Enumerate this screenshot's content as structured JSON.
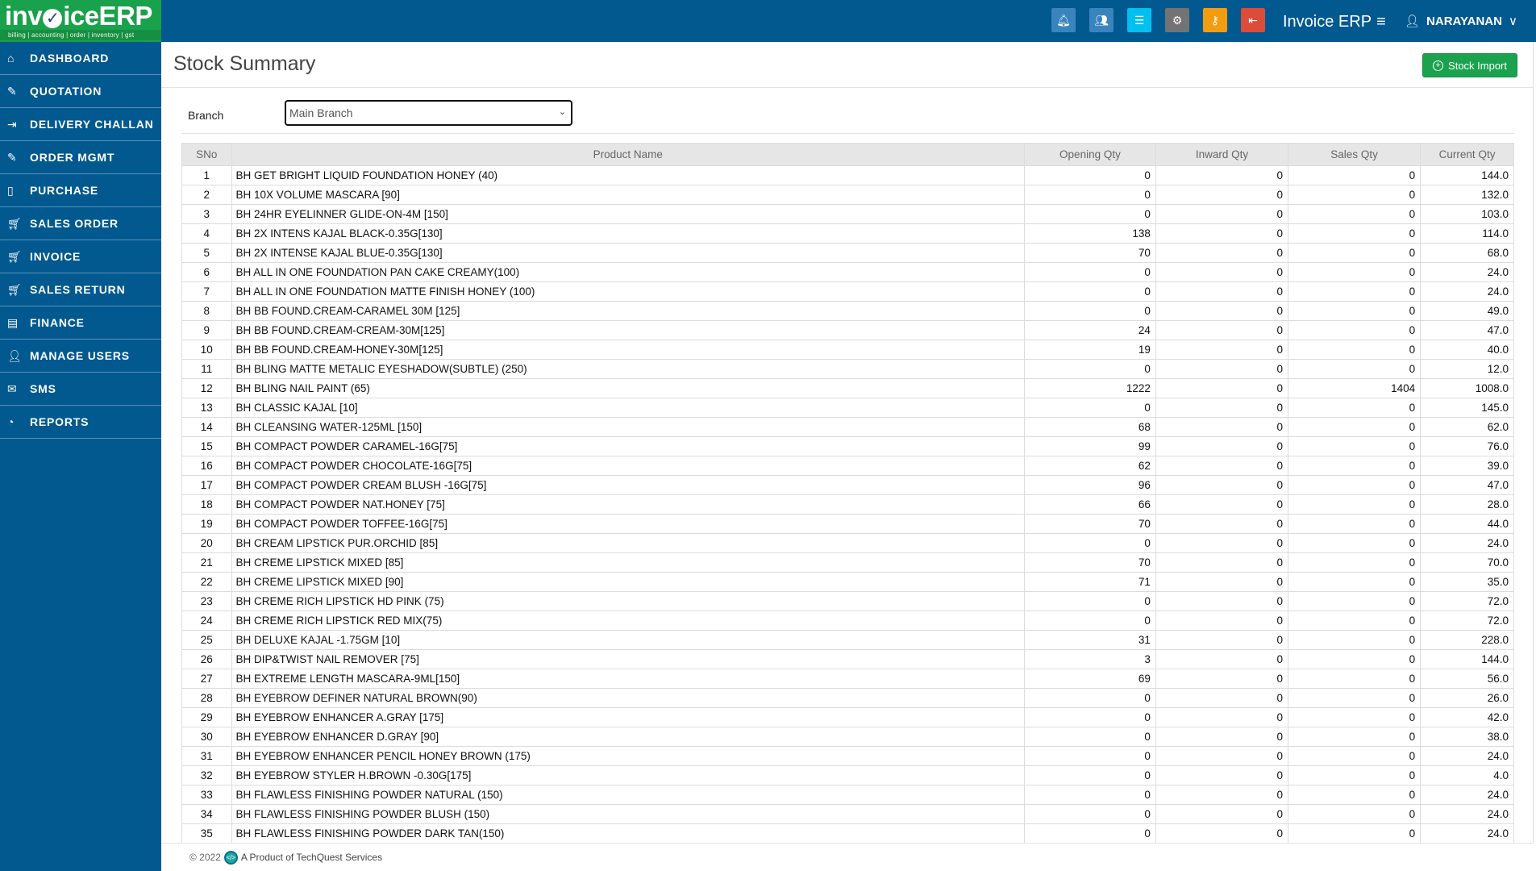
{
  "logo": {
    "brand_pre": "inv",
    "brand_v": "✓",
    "brand_post": "iceERP",
    "tagline": "billing | accounting | order | inventory | gst"
  },
  "topbar": {
    "icons": [
      {
        "name": "bell-icon",
        "glyph": "🔔︎",
        "color": "#3a84bd"
      },
      {
        "name": "users-icon",
        "glyph": "👥︎",
        "color": "#3a84bd"
      },
      {
        "name": "list-icon",
        "glyph": "☰",
        "color": "#00c0ef"
      },
      {
        "name": "gear-icon",
        "glyph": "⚙",
        "color": "#737373"
      },
      {
        "name": "key-icon",
        "glyph": "⚷",
        "color": "#f39c12"
      },
      {
        "name": "logout-icon",
        "glyph": "⇤",
        "color": "#dd4b39"
      }
    ],
    "app_title": "Invoice ERP",
    "menu_glyph": "≡",
    "user_glyph": "👤︎",
    "user_name": "NARAYANAN",
    "user_chevron": "∨"
  },
  "sidebar": {
    "items": [
      {
        "label": "DASHBOARD",
        "icon": "⌂",
        "icon_name": "home-icon"
      },
      {
        "label": "QUOTATION",
        "icon": "✎",
        "icon_name": "edit-icon"
      },
      {
        "label": "DELIVERY CHALLAN",
        "icon": "⇥",
        "icon_name": "sign-in-icon"
      },
      {
        "label": "ORDER MGMT",
        "icon": "✎",
        "icon_name": "edit-icon"
      },
      {
        "label": "PURCHASE",
        "icon": "▯",
        "icon_name": "bag-icon"
      },
      {
        "label": "SALES ORDER",
        "icon": "🛒︎",
        "icon_name": "cart-icon"
      },
      {
        "label": "INVOICE",
        "icon": "🛒︎",
        "icon_name": "cart-icon"
      },
      {
        "label": "SALES RETURN",
        "icon": "🛒︎",
        "icon_name": "cart-icon"
      },
      {
        "label": "FINANCE",
        "icon": "▤",
        "icon_name": "book-icon"
      },
      {
        "label": "MANAGE USERS",
        "icon": "👤︎",
        "icon_name": "user-icon"
      },
      {
        "label": "SMS",
        "icon": "✉",
        "icon_name": "envelope-icon"
      },
      {
        "label": "REPORTS",
        "icon": "◔",
        "icon_name": "pie-chart-icon"
      }
    ]
  },
  "page": {
    "title": "Stock Summary",
    "stock_import_label": "Stock Import",
    "stock_import_glyph": "+",
    "branch_label": "Branch",
    "branch_selected": "Main Branch",
    "select_chevron": "⌄"
  },
  "table": {
    "columns": [
      "SNo",
      "Product Name",
      "Opening Qty",
      "Inward Qty",
      "Sales Qty",
      "Current Qty"
    ],
    "rows": [
      [
        "1",
        "BH GET BRIGHT LIQUID FOUNDATION HONEY (40)",
        "0",
        "0",
        "0",
        "144.0"
      ],
      [
        "2",
        "BH 10X VOLUME MASCARA [90]",
        "0",
        "0",
        "0",
        "132.0"
      ],
      [
        "3",
        "BH 24HR EYELINNER GLIDE-ON-4M [150]",
        "0",
        "0",
        "0",
        "103.0"
      ],
      [
        "4",
        "BH 2X INTENS KAJAL BLACK-0.35G[130]",
        "138",
        "0",
        "0",
        "114.0"
      ],
      [
        "5",
        "BH 2X INTENSE KAJAL BLUE-0.35G[130]",
        "70",
        "0",
        "0",
        "68.0"
      ],
      [
        "6",
        "BH ALL IN ONE FOUNDATION PAN CAKE CREAMY(100)",
        "0",
        "0",
        "0",
        "24.0"
      ],
      [
        "7",
        "BH ALL IN ONE FOUNDATION MATTE FINISH HONEY (100)",
        "0",
        "0",
        "0",
        "24.0"
      ],
      [
        "8",
        "BH BB FOUND.CREAM-CARAMEL 30M [125]",
        "0",
        "0",
        "0",
        "49.0"
      ],
      [
        "9",
        "BH BB FOUND.CREAM-CREAM-30M[125]",
        "24",
        "0",
        "0",
        "47.0"
      ],
      [
        "10",
        "BH BB FOUND.CREAM-HONEY-30M[125]",
        "19",
        "0",
        "0",
        "40.0"
      ],
      [
        "11",
        "BH BLING MATTE METALIC EYESHADOW(SUBTLE) (250)",
        "0",
        "0",
        "0",
        "12.0"
      ],
      [
        "12",
        "BH BLING NAIL PAINT (65)",
        "1222",
        "0",
        "1404",
        "1008.0"
      ],
      [
        "13",
        "BH CLASSIC KAJAL [10]",
        "0",
        "0",
        "0",
        "145.0"
      ],
      [
        "14",
        "BH CLEANSING WATER-125ML [150]",
        "68",
        "0",
        "0",
        "62.0"
      ],
      [
        "15",
        "BH COMPACT POWDER CARAMEL-16G[75]",
        "99",
        "0",
        "0",
        "76.0"
      ],
      [
        "16",
        "BH COMPACT POWDER CHOCOLATE-16G[75]",
        "62",
        "0",
        "0",
        "39.0"
      ],
      [
        "17",
        "BH COMPACT POWDER CREAM BLUSH -16G[75]",
        "96",
        "0",
        "0",
        "47.0"
      ],
      [
        "18",
        "BH COMPACT POWDER NAT.HONEY [75]",
        "66",
        "0",
        "0",
        "28.0"
      ],
      [
        "19",
        "BH COMPACT POWDER TOFFEE-16G[75]",
        "70",
        "0",
        "0",
        "44.0"
      ],
      [
        "20",
        "BH CREAM LIPSTICK PUR.ORCHID [85]",
        "0",
        "0",
        "0",
        "24.0"
      ],
      [
        "21",
        "BH CREME LIPSTICK MIXED [85]",
        "70",
        "0",
        "0",
        "70.0"
      ],
      [
        "22",
        "BH CREME LIPSTICK MIXED [90]",
        "71",
        "0",
        "0",
        "35.0"
      ],
      [
        "23",
        "BH CREME RICH LIPSTICK HD PINK (75)",
        "0",
        "0",
        "0",
        "72.0"
      ],
      [
        "24",
        "BH CREME RICH LIPSTICK RED MIX(75)",
        "0",
        "0",
        "0",
        "72.0"
      ],
      [
        "25",
        "BH DELUXE KAJAL -1.75GM [10]",
        "31",
        "0",
        "0",
        "228.0"
      ],
      [
        "26",
        "BH DIP&TWIST NAIL REMOVER [75]",
        "3",
        "0",
        "0",
        "144.0"
      ],
      [
        "27",
        "BH EXTREME LENGTH MASCARA-9ML[150]",
        "69",
        "0",
        "0",
        "56.0"
      ],
      [
        "28",
        "BH EYEBROW DEFINER NATURAL BROWN(90)",
        "0",
        "0",
        "0",
        "26.0"
      ],
      [
        "29",
        "BH EYEBROW ENHANCER A.GRAY [175]",
        "0",
        "0",
        "0",
        "42.0"
      ],
      [
        "30",
        "BH EYEBROW ENHANCER D.GRAY [90]",
        "0",
        "0",
        "0",
        "38.0"
      ],
      [
        "31",
        "BH EYEBROW ENHANCER PENCIL HONEY BROWN (175)",
        "0",
        "0",
        "0",
        "24.0"
      ],
      [
        "32",
        "BH EYEBROW STYLER H.BROWN -0.30G[175]",
        "0",
        "0",
        "0",
        "4.0"
      ],
      [
        "33",
        "BH FLAWLESS FINISHING POWDER NATURAL (150)",
        "0",
        "0",
        "0",
        "24.0"
      ],
      [
        "34",
        "BH FLAWLESS FINISHING POWDER BLUSH (150)",
        "0",
        "0",
        "0",
        "24.0"
      ],
      [
        "35",
        "BH FLAWLESS FINISHING POWDER DARK TAN(150)",
        "0",
        "0",
        "0",
        "24.0"
      ]
    ]
  },
  "footer": {
    "copyright": "© 2022",
    "logo_glyph": "</>",
    "text": "A Product of TechQuest Services"
  }
}
